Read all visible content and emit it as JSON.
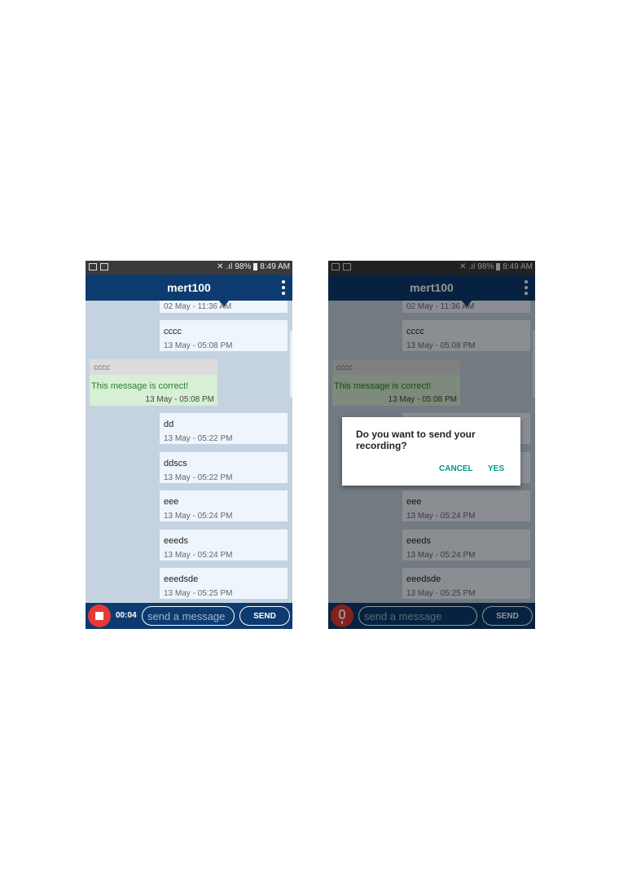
{
  "status_bar": {
    "battery": "98%",
    "time": "8:49 AM"
  },
  "chat": {
    "title": "mert100"
  },
  "messages": [
    {
      "text": "",
      "time": "02 May - 11:36 AM"
    },
    {
      "text": "cccc",
      "time": "13 May - 05:08 PM"
    },
    {
      "text": "dd",
      "time": "13 May - 05:22 PM"
    },
    {
      "text": "ddscs",
      "time": "13 May - 05:22 PM"
    },
    {
      "text": "eee",
      "time": "13 May - 05:24 PM"
    },
    {
      "text": "eeeds",
      "time": "13 May - 05:24 PM"
    },
    {
      "text": "eeedsde",
      "time": "13 May - 05:25 PM"
    }
  ],
  "incoming": {
    "quoted": "cccc",
    "text": "This message is correct!",
    "time": "13 May - 05:08 PM"
  },
  "composer": {
    "timer": "00:04",
    "placeholder": "send a message",
    "send_label": "SEND"
  },
  "dialog": {
    "message": "Do you want to send your recording?",
    "cancel_label": "CANCEL",
    "yes_label": "YES"
  },
  "colors": {
    "app_bar": "#0d3b70",
    "chat_bg": "#c5d3e0",
    "record": "#e53935",
    "dialog_accent": "#009688"
  }
}
